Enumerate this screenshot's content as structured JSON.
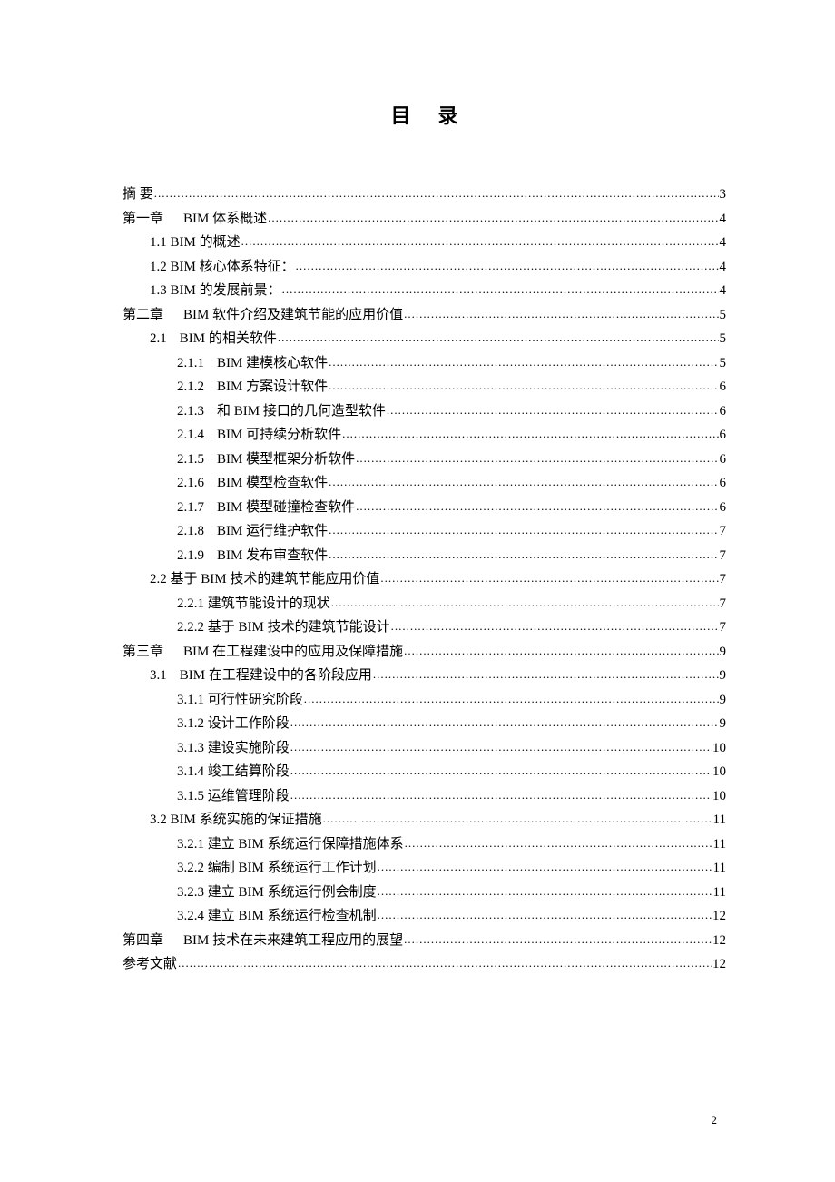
{
  "title": "目录",
  "pageNumber": "2",
  "entries": [
    {
      "indent": 0,
      "label": "摘    要",
      "page": "3",
      "abstract": true
    },
    {
      "indent": 0,
      "label": "第一章",
      "title": "BIM 体系概述",
      "page": "4",
      "chap": true
    },
    {
      "indent": 1,
      "label": "1.1 BIM 的概述",
      "page": "4"
    },
    {
      "indent": 1,
      "label": "1.2 BIM 核心体系特征：",
      "page": "4"
    },
    {
      "indent": 1,
      "label": "1.3 BIM 的发展前景：",
      "page": "4"
    },
    {
      "indent": 0,
      "label": "第二章",
      "title": "BIM 软件介绍及建筑节能的应用价值",
      "page": "5",
      "chap": true
    },
    {
      "indent": 1,
      "label": "2.1",
      "title": "BIM 的相关软件",
      "page": "5",
      "sec": true
    },
    {
      "indent": 2,
      "label": "2.1.1",
      "title": "BIM 建模核心软件",
      "page": "5",
      "sub": true
    },
    {
      "indent": 2,
      "label": "2.1.2",
      "title": "BIM 方案设计软件",
      "page": "6",
      "sub": true
    },
    {
      "indent": 2,
      "label": "2.1.3",
      "title": "和 BIM 接口的几何造型软件",
      "page": "6",
      "sub": true
    },
    {
      "indent": 2,
      "label": "2.1.4",
      "title": "BIM 可持续分析软件",
      "page": "6",
      "sub": true
    },
    {
      "indent": 2,
      "label": "2.1.5",
      "title": "BIM 模型框架分析软件",
      "page": "6",
      "sub": true
    },
    {
      "indent": 2,
      "label": "2.1.6",
      "title": "BIM 模型检查软件",
      "page": "6",
      "sub": true
    },
    {
      "indent": 2,
      "label": "2.1.7",
      "title": "BIM 模型碰撞检查软件",
      "page": "6",
      "sub": true
    },
    {
      "indent": 2,
      "label": "2.1.8",
      "title": "BIM 运行维护软件",
      "page": "7",
      "sub": true
    },
    {
      "indent": 2,
      "label": "2.1.9",
      "title": "BIM 发布审查软件",
      "page": "7",
      "sub": true
    },
    {
      "indent": 1,
      "label": "2.2 基于 BIM 技术的建筑节能应用价值",
      "page": "7"
    },
    {
      "indent": 2,
      "label": "2.2.1 建筑节能设计的现状",
      "page": "7"
    },
    {
      "indent": 2,
      "label": "2.2.2 基于 BIM 技术的建筑节能设计",
      "page": "7"
    },
    {
      "indent": 0,
      "label": "第三章",
      "title": "BIM 在工程建设中的应用及保障措施",
      "page": "9",
      "chap": true
    },
    {
      "indent": 1,
      "label": "3.1",
      "title": "BIM 在工程建设中的各阶段应用",
      "page": "9",
      "sec": true
    },
    {
      "indent": 2,
      "label": "3.1.1 可行性研究阶段",
      "page": "9"
    },
    {
      "indent": 2,
      "label": "3.1.2 设计工作阶段",
      "page": "9"
    },
    {
      "indent": 2,
      "label": "3.1.3 建设实施阶段",
      "page": "10"
    },
    {
      "indent": 2,
      "label": "3.1.4 竣工结算阶段",
      "page": "10"
    },
    {
      "indent": 2,
      "label": "3.1.5 运维管理阶段",
      "page": "10"
    },
    {
      "indent": 1,
      "label": "3.2 BIM 系统实施的保证措施",
      "page": "11"
    },
    {
      "indent": 2,
      "label": "3.2.1 建立 BIM 系统运行保障措施体系",
      "page": "11"
    },
    {
      "indent": 2,
      "label": "3.2.2 编制 BIM 系统运行工作计划",
      "page": "11"
    },
    {
      "indent": 2,
      "label": "3.2.3 建立 BIM 系统运行例会制度",
      "page": "11"
    },
    {
      "indent": 2,
      "label": "3.2.4 建立 BIM 系统运行检查机制",
      "page": "12"
    },
    {
      "indent": 0,
      "label": "第四章",
      "title": "BIM 技术在未来建筑工程应用的展望",
      "page": "12",
      "chap": true
    },
    {
      "indent": 0,
      "label": "参考文献",
      "page": "12"
    }
  ]
}
